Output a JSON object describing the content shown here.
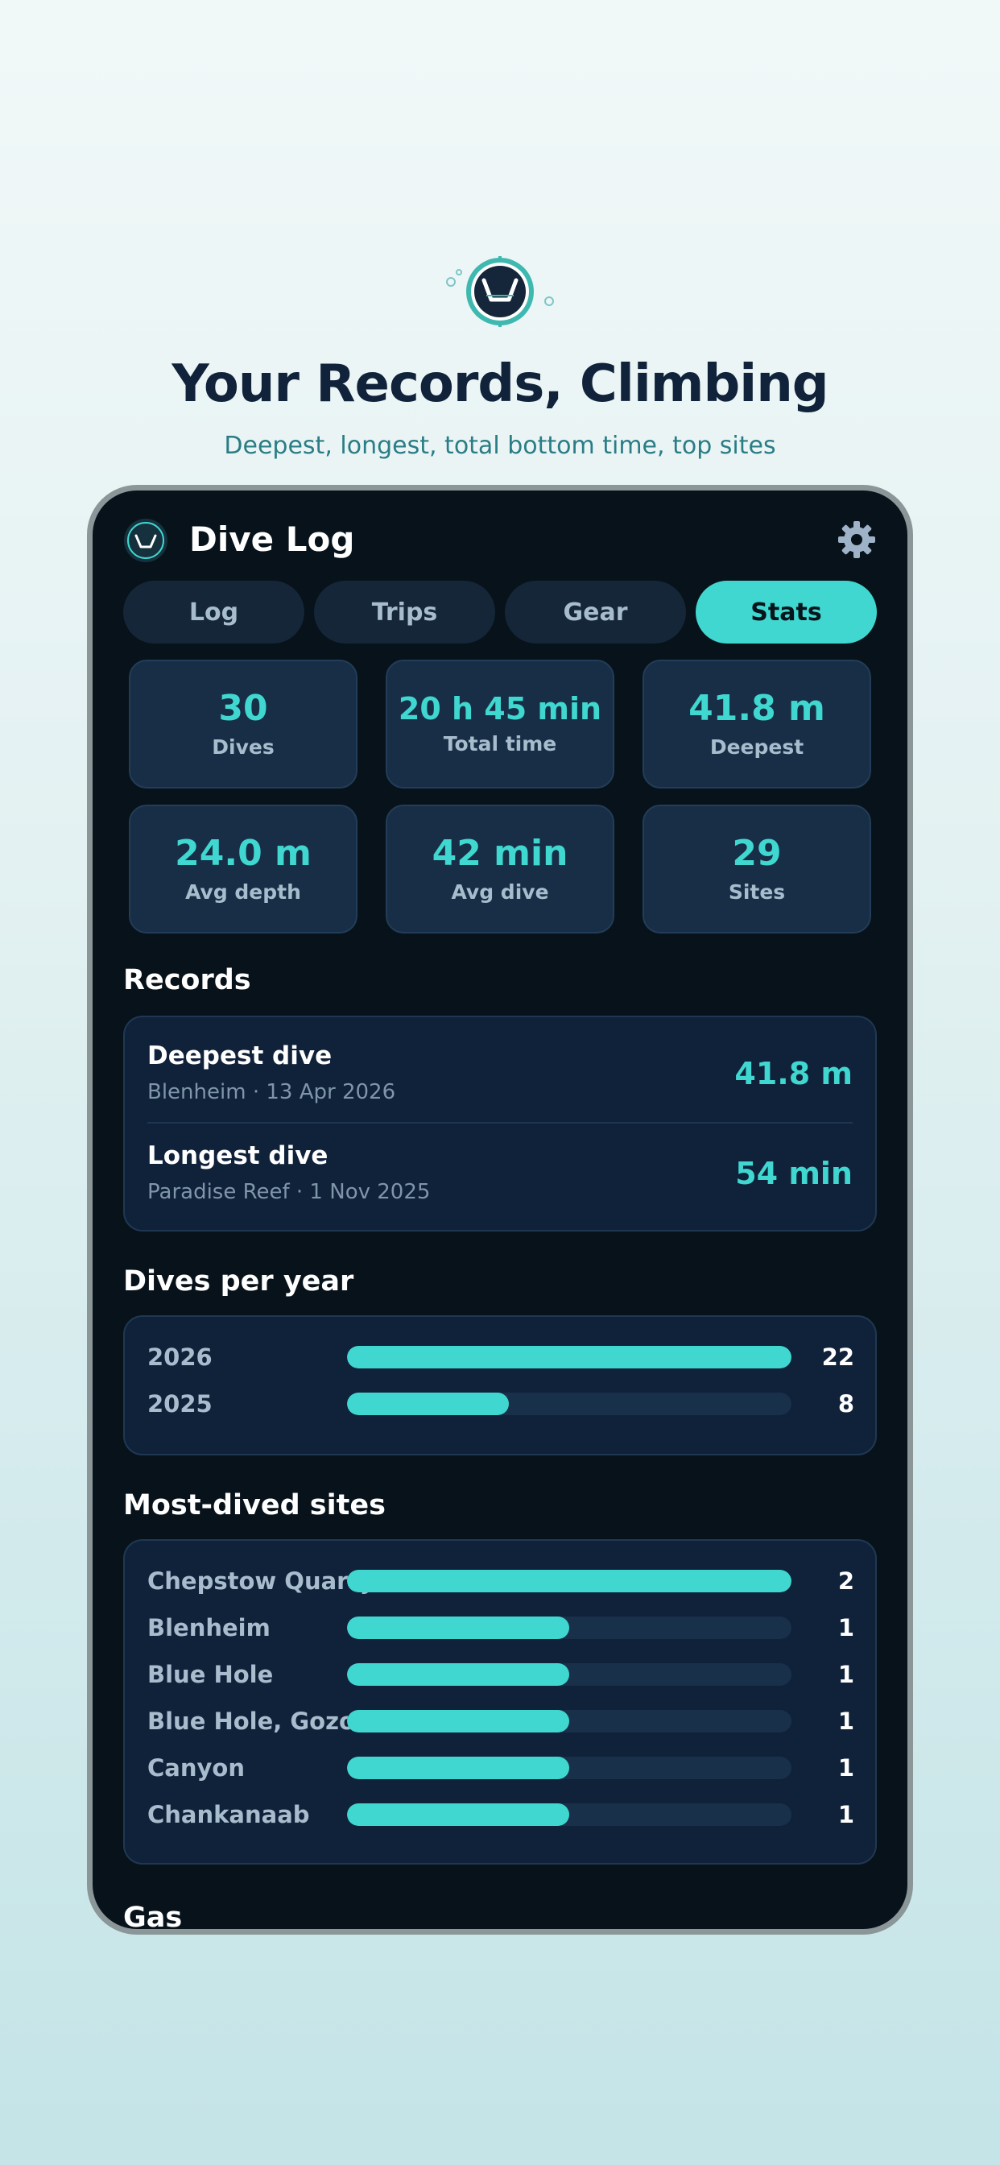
{
  "hero": {
    "title": "Your Records, Climbing",
    "subtitle": "Deepest, longest, total bottom time, top sites"
  },
  "app": {
    "title": "Dive Log",
    "icons": {
      "logo": "depth-profile-icon",
      "settings": "gear-icon"
    }
  },
  "tabs": [
    {
      "label": "Log",
      "active": false
    },
    {
      "label": "Trips",
      "active": false
    },
    {
      "label": "Gear",
      "active": false
    },
    {
      "label": "Stats",
      "active": true
    }
  ],
  "stats": [
    {
      "value": "30",
      "label": "Dives"
    },
    {
      "value": "20 h 45 min",
      "label": "Total time"
    },
    {
      "value": "41.8 m",
      "label": "Deepest"
    },
    {
      "value": "24.0 m",
      "label": "Avg depth"
    },
    {
      "value": "42 min",
      "label": "Avg dive"
    },
    {
      "value": "29",
      "label": "Sites"
    }
  ],
  "records": {
    "title": "Records",
    "items": [
      {
        "name": "Deepest dive",
        "meta": "Blenheim · 13 Apr 2026",
        "value": "41.8 m"
      },
      {
        "name": "Longest dive",
        "meta": "Paradise Reef · 1 Nov 2025",
        "value": "54 min"
      }
    ]
  },
  "dives_per_year": {
    "title": "Dives per year",
    "max": 22,
    "rows": [
      {
        "label": "2026",
        "count": 22
      },
      {
        "label": "2025",
        "count": 8
      }
    ]
  },
  "top_sites": {
    "title": "Most-dived sites",
    "max": 2,
    "rows": [
      {
        "label": "Chepstow Quarry",
        "count": 2
      },
      {
        "label": "Blenheim",
        "count": 1
      },
      {
        "label": "Blue Hole",
        "count": 1
      },
      {
        "label": "Blue Hole, Gozo",
        "count": 1
      },
      {
        "label": "Canyon",
        "count": 1
      },
      {
        "label": "Chankanaab",
        "count": 1
      }
    ]
  },
  "gas": {
    "title": "Gas"
  },
  "colors": {
    "accent": "#3fd7cf",
    "panel": "#08121a",
    "card": "#10213a",
    "heading": "#10233a"
  }
}
